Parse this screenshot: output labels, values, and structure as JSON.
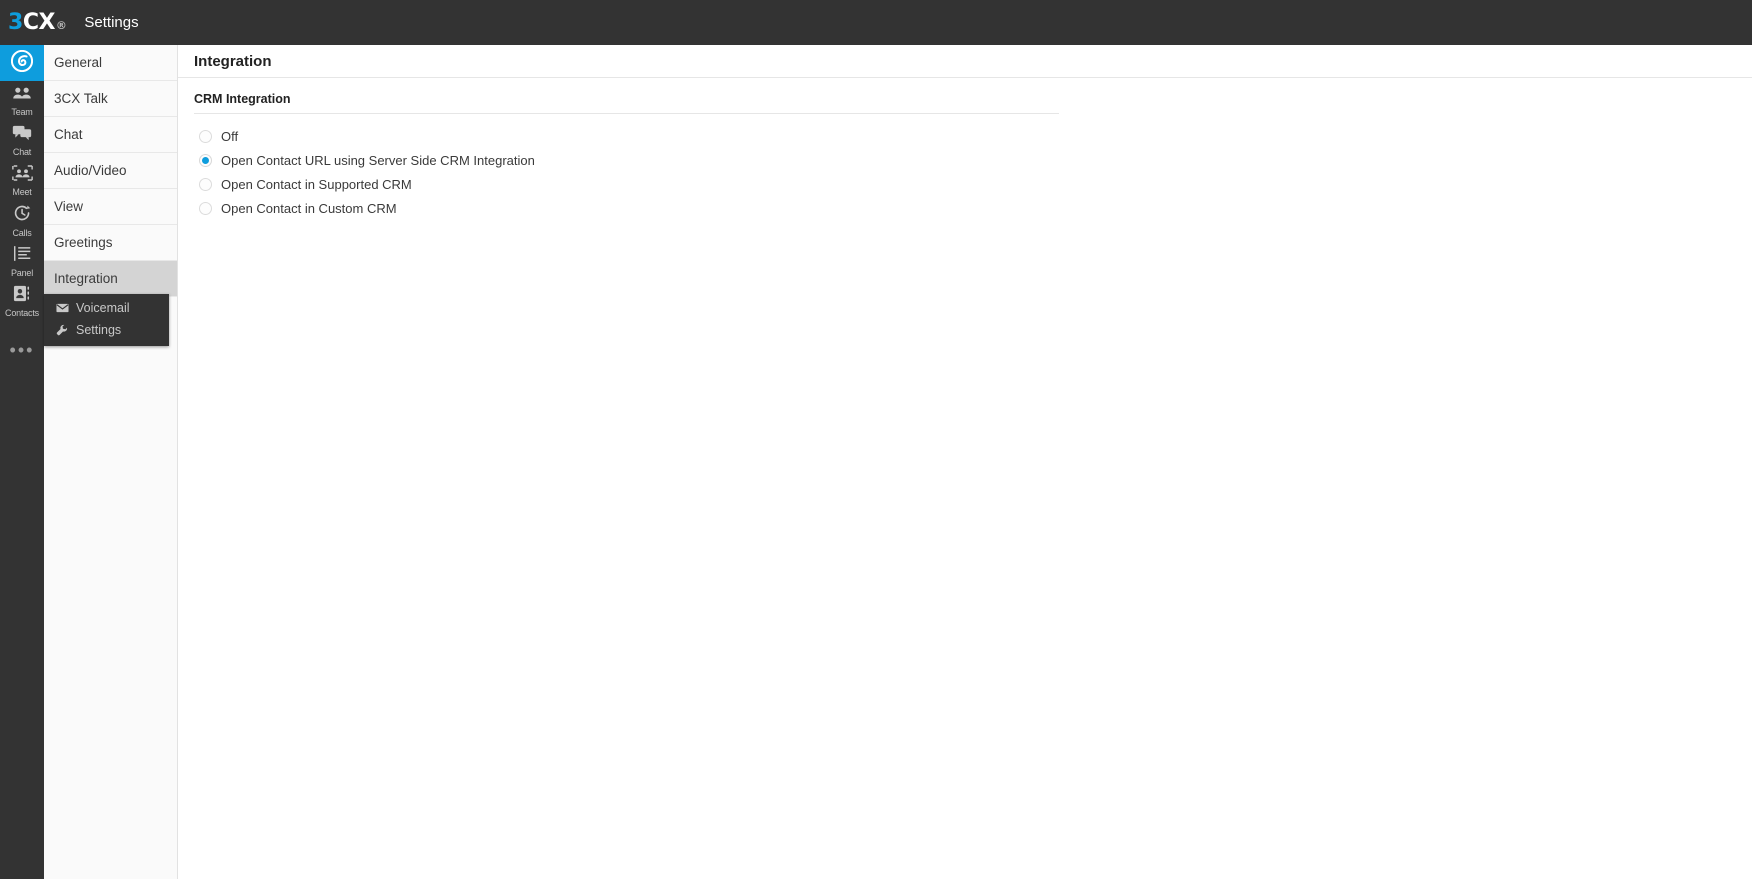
{
  "topbar": {
    "logo_3": "3",
    "logo_cx": "CX",
    "logo_dot": "®",
    "title": "Settings"
  },
  "rail": {
    "items": [
      {
        "label": "",
        "icon": "3cx-swirl-icon",
        "active": true
      },
      {
        "label": "Team",
        "icon": "people-icon",
        "active": false
      },
      {
        "label": "Chat",
        "icon": "chat-bubbles-icon",
        "active": false
      },
      {
        "label": "Meet",
        "icon": "meeting-icon",
        "active": false
      },
      {
        "label": "Calls",
        "icon": "call-history-icon",
        "active": false
      },
      {
        "label": "Panel",
        "icon": "panel-list-icon",
        "active": false
      },
      {
        "label": "Contacts",
        "icon": "contact-card-icon",
        "active": false
      }
    ],
    "more_label": "•••"
  },
  "nav": {
    "items": [
      {
        "label": "General",
        "selected": false
      },
      {
        "label": "3CX Talk",
        "selected": false
      },
      {
        "label": "Chat",
        "selected": false
      },
      {
        "label": "Audio/Video",
        "selected": false
      },
      {
        "label": "View",
        "selected": false
      },
      {
        "label": "Greetings",
        "selected": false
      },
      {
        "label": "Integration",
        "selected": true
      }
    ]
  },
  "popup": {
    "items": [
      {
        "label": "Voicemail",
        "icon": "envelope-icon"
      },
      {
        "label": "Settings",
        "icon": "wrench-icon"
      }
    ]
  },
  "main": {
    "page_title": "Integration",
    "section_title": "CRM Integration",
    "radio_group": {
      "name": "crm-integration-mode",
      "options": [
        {
          "label": "Off",
          "checked": false
        },
        {
          "label": "Open Contact URL using Server Side CRM Integration",
          "checked": true
        },
        {
          "label": "Open Contact in Supported CRM",
          "checked": false
        },
        {
          "label": "Open Contact in Custom CRM",
          "checked": false
        }
      ]
    }
  },
  "colors": {
    "accent": "#0e9ddd",
    "dark": "#333333",
    "selected_nav": "#d4d4d4",
    "nav_bg": "#fafafa"
  }
}
